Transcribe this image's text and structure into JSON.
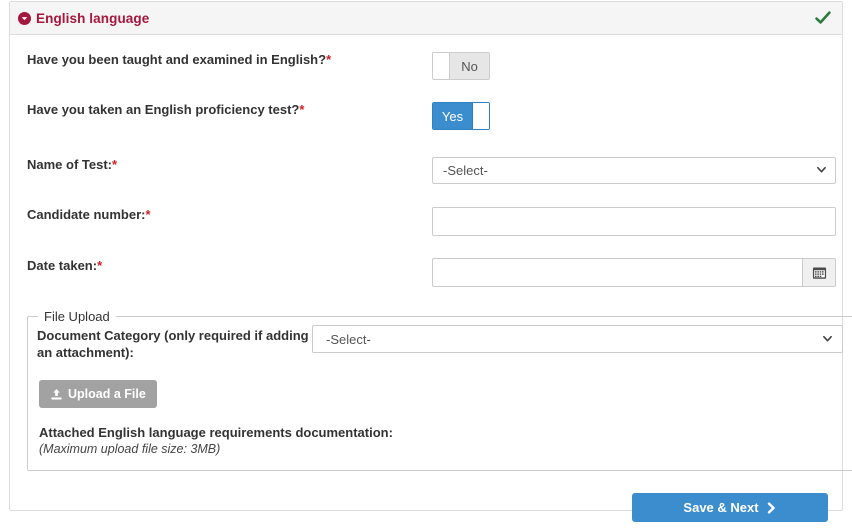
{
  "panel": {
    "title": "English language",
    "collapse_icon": "circle-caret-down-icon",
    "status_icon": "green-check-icon",
    "header_bg": "#f5f5f5",
    "title_color": "#a5173c",
    "status_color": "#2d7a3e"
  },
  "fields": {
    "taught_in_english": {
      "label": "Have you been taught and examined in English?",
      "required_marker": "*",
      "toggle_value": "No",
      "toggle_state": "off"
    },
    "proficiency_test": {
      "label": "Have you taken an English proficiency test?",
      "required_marker": "*",
      "toggle_value": "Yes",
      "toggle_state": "on",
      "accent": "#3c8dce"
    },
    "name_of_test": {
      "label": "Name of Test:",
      "required_marker": "*",
      "value": "-Select-"
    },
    "candidate_number": {
      "label": "Candidate number:",
      "required_marker": "*",
      "value": "",
      "placeholder": ""
    },
    "date_taken": {
      "label": "Date taken:",
      "required_marker": "*",
      "value": "",
      "placeholder": "",
      "calendar_button_icon": "calendar-icon"
    }
  },
  "file_upload": {
    "legend": "File Upload",
    "document_category_label": "Document Category (only required if adding an attachment):",
    "document_category_value": "-Select-",
    "upload_button_label": "Upload a File",
    "upload_button_icon": "upload-icon",
    "attached_title": "Attached English language requirements documentation:",
    "max_size_note": "(Maximum upload file size: 3MB)"
  },
  "footer": {
    "save_next_label": "Save & Next",
    "save_next_icon": "chevron-right-icon",
    "save_next_color": "#3c8dce"
  }
}
